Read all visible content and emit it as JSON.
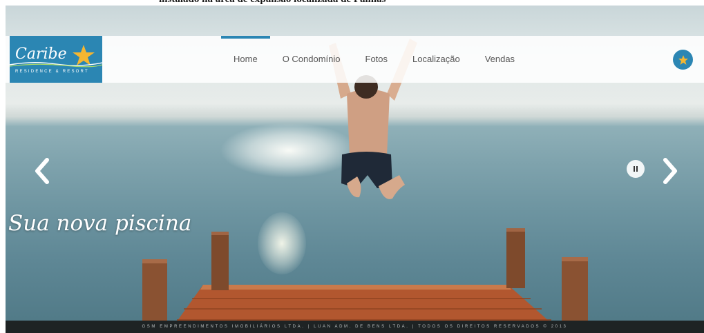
{
  "page": {
    "caption_above": "instalado na área de expansão localizada de Palmas"
  },
  "logo": {
    "name": "Caribe",
    "subtitle": "RESIDENCE & RESORT",
    "icon": "starfish-icon"
  },
  "nav": {
    "items": [
      {
        "label": "Home",
        "active": true
      },
      {
        "label": "O Condomínio",
        "active": false
      },
      {
        "label": "Fotos",
        "active": false
      },
      {
        "label": "Localização",
        "active": false
      },
      {
        "label": "Vendas",
        "active": false
      }
    ],
    "favorite_icon": "star-icon"
  },
  "slider": {
    "caption": "Sua nova piscina",
    "prev_icon": "chevron-left-icon",
    "next_icon": "chevron-right-icon",
    "pause_icon": "pause-icon"
  },
  "footer": {
    "text": "GSM EMPREENDIMENTOS IMOBILIÁRIOS LTDA. | LUAN ADM. DE BENS LTDA. | TODOS OS DIREITOS RESERVADOS © 2013"
  },
  "colors": {
    "brand_blue": "#2b86b3",
    "starfish": "#f4b631",
    "footer_bg": "#1e2324"
  }
}
